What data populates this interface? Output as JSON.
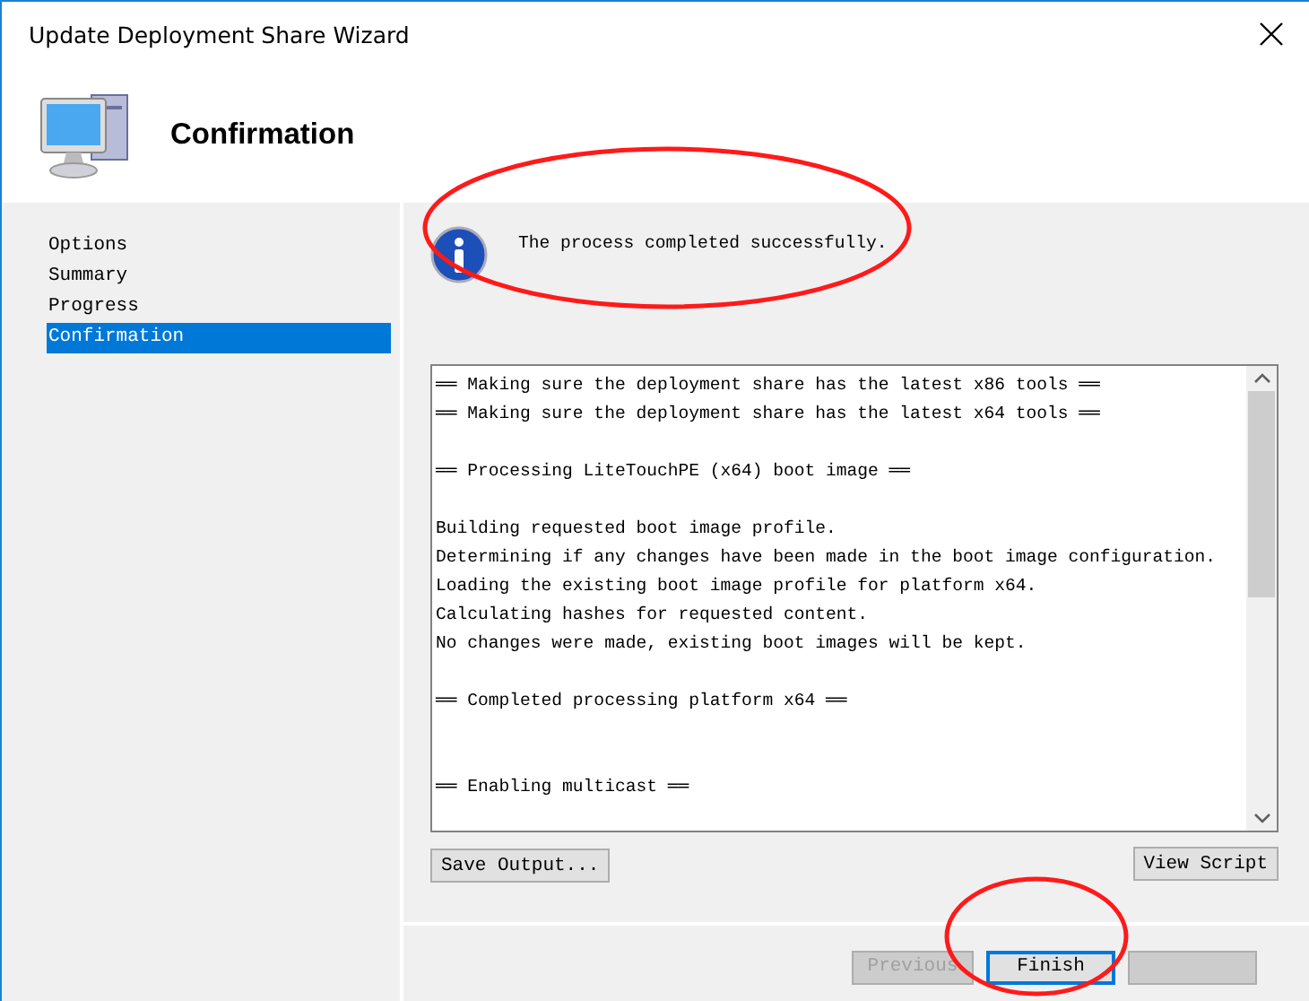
{
  "window": {
    "title": "Update Deployment Share Wizard"
  },
  "header": {
    "title": "Confirmation"
  },
  "steps": [
    {
      "label": "Options",
      "selected": false
    },
    {
      "label": "Summary",
      "selected": false
    },
    {
      "label": "Progress",
      "selected": false
    },
    {
      "label": "Confirmation",
      "selected": true
    }
  ],
  "message": "The process completed successfully.",
  "output": [
    {
      "kind": "line",
      "text": "══ Making sure the deployment share has the latest x86 tools ══"
    },
    {
      "kind": "line",
      "text": "══ Making sure the deployment share has the latest x64 tools ══"
    },
    {
      "kind": "blank"
    },
    {
      "kind": "line",
      "text": "══ Processing LiteTouchPE (x64) boot image ══"
    },
    {
      "kind": "blank"
    },
    {
      "kind": "line",
      "text": "Building requested boot image profile."
    },
    {
      "kind": "line",
      "text": "Determining if any changes have been made in the boot image configuration."
    },
    {
      "kind": "line",
      "text": "Loading the existing boot image profile for platform x64."
    },
    {
      "kind": "line",
      "text": "Calculating hashes for requested content."
    },
    {
      "kind": "line",
      "text": "No changes were made, existing boot images will be kept."
    },
    {
      "kind": "blank"
    },
    {
      "kind": "line",
      "text": "══ Completed processing platform x64 ══"
    },
    {
      "kind": "blank"
    },
    {
      "kind": "blank"
    },
    {
      "kind": "line",
      "text": "══ Enabling multicast ══"
    }
  ],
  "save_button": "Save Output...",
  "view_script_button": "View Script",
  "footer_buttons": [
    {
      "kind": "button",
      "label": "Previous",
      "disabled": true,
      "default": false
    },
    {
      "kind": "button",
      "label": "Finish",
      "disabled": false,
      "default": true
    },
    {
      "kind": "hidden",
      "disabled": true,
      "default": false
    }
  ]
}
